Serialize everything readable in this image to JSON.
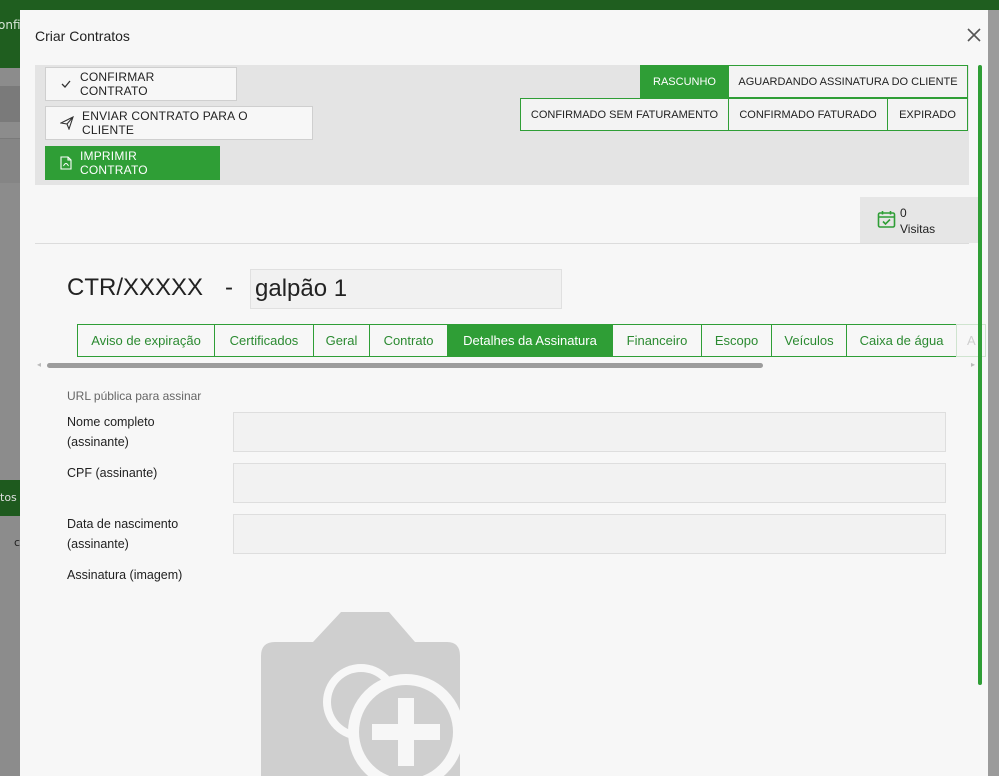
{
  "background": {
    "topbar_text": "onfi",
    "side_band_text": "tos",
    "side_letter": "c"
  },
  "modal": {
    "title": "Criar Contratos",
    "close_icon": "close-icon"
  },
  "toolbar": {
    "confirm_label": "CONFIRMAR CONTRATO",
    "send_label": "ENVIAR CONTRATO PARA O CLIENTE",
    "print_label": "IMPRIMIR CONTRATO"
  },
  "statuses": {
    "draft": "RASCUNHO",
    "awaiting": "AGUARDANDO ASSINATURA DO CLIENTE",
    "confirmed_no_billing": "CONFIRMADO SEM FATURAMENTO",
    "confirmed_billed": "CONFIRMADO FATURADO",
    "expired": "EXPIRADO",
    "active": "RASCUNHO"
  },
  "visits": {
    "count": "0",
    "label": "Visitas"
  },
  "contract": {
    "code": "CTR/XXXXX",
    "separator": "-",
    "name": "galpão 1"
  },
  "tabs": [
    {
      "label": "Aviso de expiração"
    },
    {
      "label": "Certificados"
    },
    {
      "label": "Geral"
    },
    {
      "label": "Contrato"
    },
    {
      "label": "Detalhes da Assinatura"
    },
    {
      "label": "Financeiro"
    },
    {
      "label": "Escopo"
    },
    {
      "label": "Veículos"
    },
    {
      "label": "Caixa de água"
    },
    {
      "label": "A"
    }
  ],
  "active_tab": "Detalhes da Assinatura",
  "form": {
    "url_label": "URL pública para assinar",
    "full_name_label_1": "Nome completo",
    "full_name_label_2": "(assinante)",
    "full_name_value": "",
    "cpf_label": "CPF (assinante)",
    "cpf_value": "",
    "birth_label_1": "Data de nascimento",
    "birth_label_2": "(assinante)",
    "birth_value": "",
    "signature_label": "Assinatura (imagem)"
  },
  "colors": {
    "accent": "#2f9e36",
    "dark_green": "#1f5e1f"
  }
}
